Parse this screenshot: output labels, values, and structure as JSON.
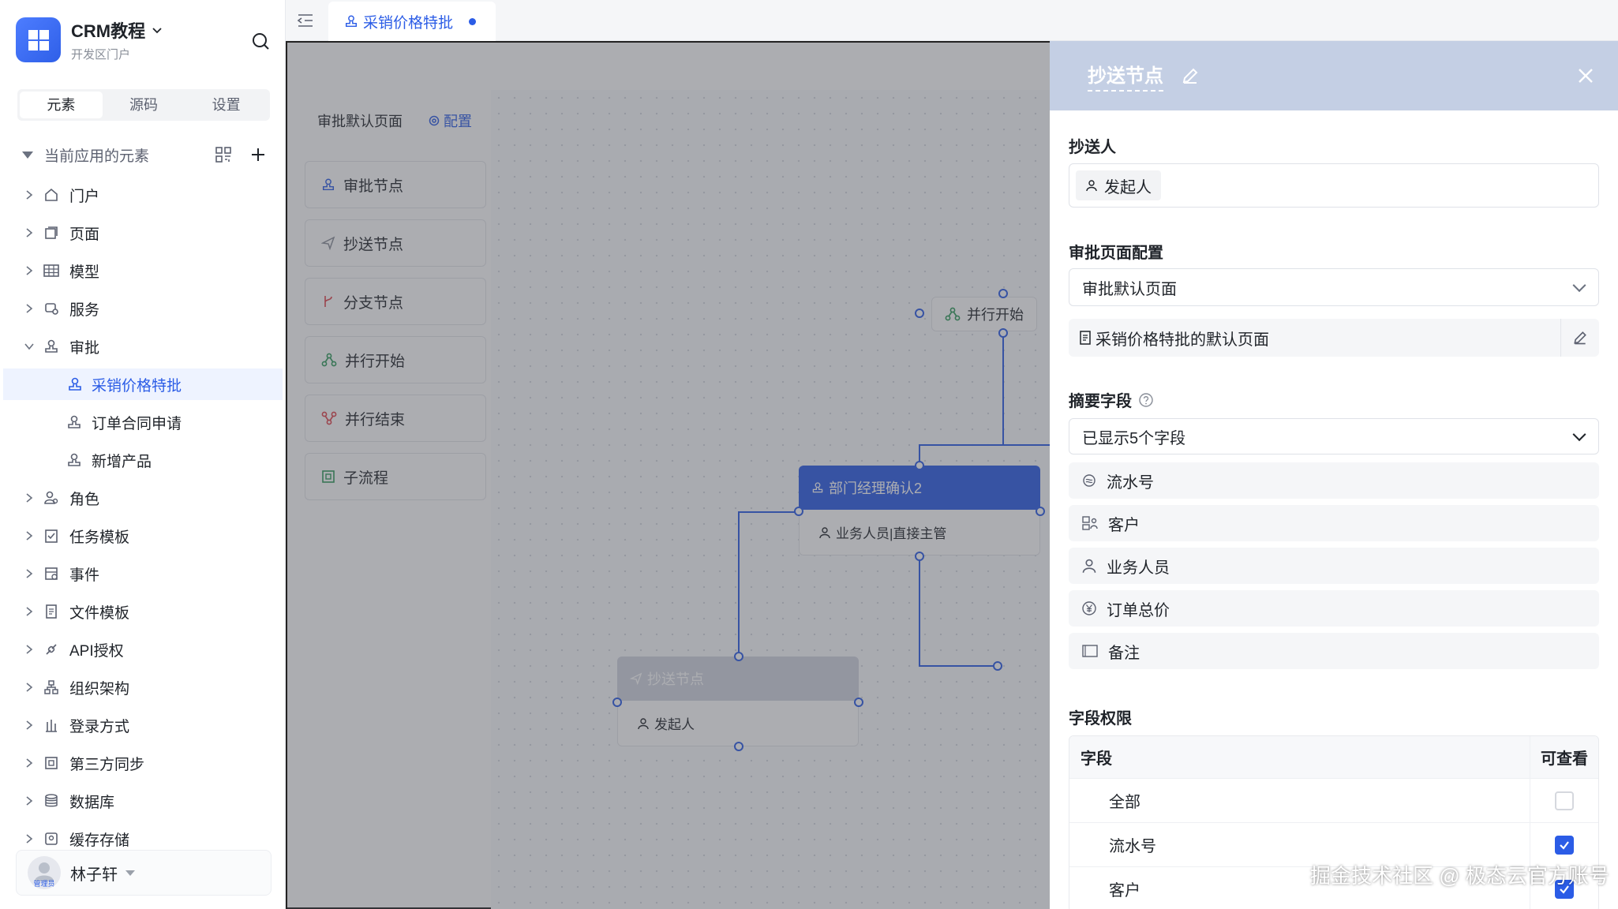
{
  "app": {
    "name": "CRM教程",
    "subtitle": "开发区门户"
  },
  "sidebar_tabs": [
    "元素",
    "源码",
    "设置"
  ],
  "tree": {
    "section_label": "当前应用的元素",
    "items": [
      {
        "label": "门户",
        "icon": "home-icon"
      },
      {
        "label": "页面",
        "icon": "pages-icon"
      },
      {
        "label": "模型",
        "icon": "table-icon"
      },
      {
        "label": "服务",
        "icon": "service-icon"
      },
      {
        "label": "审批",
        "icon": "stamp-icon"
      },
      {
        "label": "采销价格特批",
        "icon": "stamp-icon"
      },
      {
        "label": "订单合同申请",
        "icon": "stamp-icon"
      },
      {
        "label": "新增产品",
        "icon": "stamp-icon"
      },
      {
        "label": "角色",
        "icon": "role-icon"
      },
      {
        "label": "任务模板",
        "icon": "task-icon"
      },
      {
        "label": "事件",
        "icon": "event-icon"
      },
      {
        "label": "文件模板",
        "icon": "file-icon"
      },
      {
        "label": "API授权",
        "icon": "api-icon"
      },
      {
        "label": "组织架构",
        "icon": "org-icon"
      },
      {
        "label": "登录方式",
        "icon": "login-icon"
      },
      {
        "label": "第三方同步",
        "icon": "sync-icon"
      },
      {
        "label": "数据库",
        "icon": "database-icon"
      },
      {
        "label": "缓存存储",
        "icon": "cache-icon"
      }
    ]
  },
  "user": {
    "name": "林子轩",
    "badge": "管理员"
  },
  "doc_tab": {
    "label": "采销价格特批"
  },
  "palette": {
    "header": "审批默认页面",
    "config_label": "配置",
    "items": [
      "审批节点",
      "抄送节点",
      "分支节点",
      "并行开始",
      "并行结束",
      "子流程"
    ]
  },
  "flow": {
    "parallel_start": "并行开始",
    "approve_node": {
      "title": "部门经理确认2",
      "assignee": "业务人员|直接主管"
    },
    "cc_node": {
      "title": "抄送节点",
      "assignee": "发起人"
    }
  },
  "drawer": {
    "title": "抄送节点",
    "cc_label": "抄送人",
    "cc_value": "发起人",
    "page_config_label": "审批页面配置",
    "page_select": "审批默认页面",
    "page_link": "采销价格特批的默认页面",
    "summary_label": "摘要字段",
    "summary_select": "已显示5个字段",
    "summary_fields": [
      "流水号",
      "客户",
      "业务人员",
      "订单总价",
      "备注"
    ],
    "perm_label": "字段权限",
    "perm_headers": [
      "字段",
      "可查看"
    ],
    "perm_rows": [
      {
        "field": "全部",
        "visible": false
      },
      {
        "field": "流水号",
        "visible": true
      },
      {
        "field": "客户",
        "visible": true
      }
    ]
  },
  "watermark": "掘金技术社区 @ 极态云官方账号",
  "colors": {
    "accent": "#2b5ce6",
    "drawer_header": "#c4cfe4",
    "parallel_green": "#2e9b5a",
    "parallel_end_red": "#e0434b"
  }
}
